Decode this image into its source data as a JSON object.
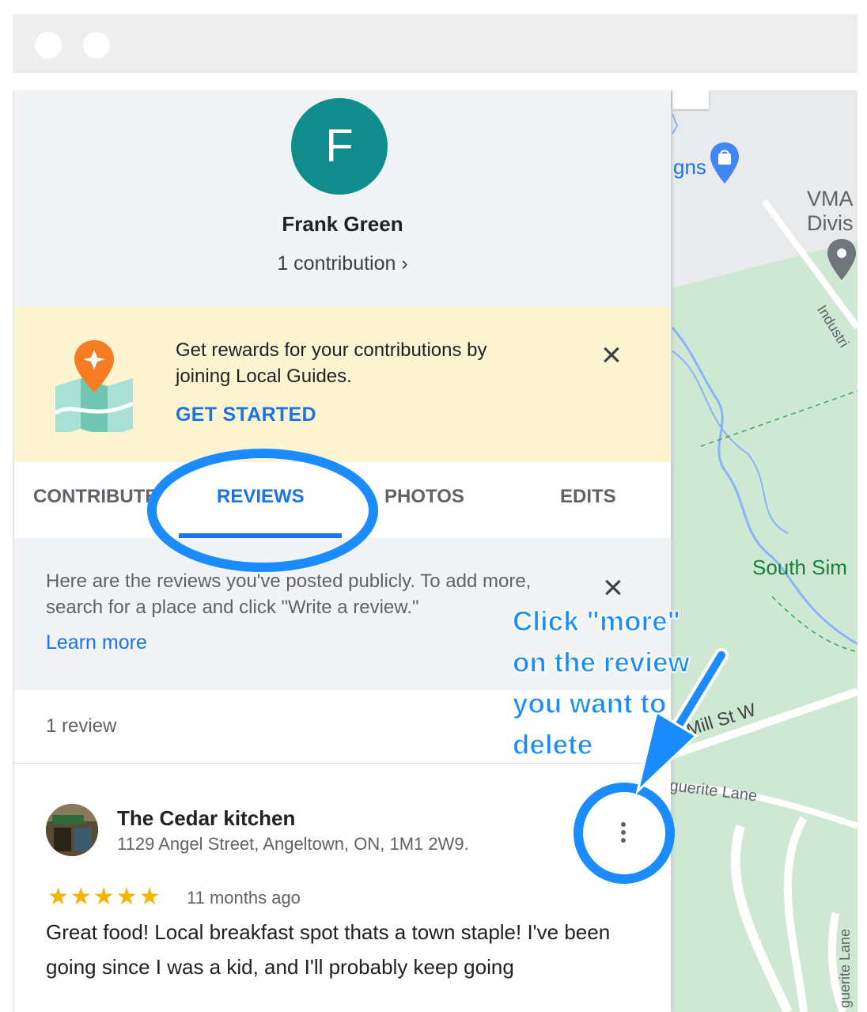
{
  "map": {
    "labels": {
      "signs": "gns",
      "vma": "VMA\nDivis",
      "south": "South Sim",
      "mill": "Mill St W",
      "marguerite": "guerite Lane",
      "industrial": "Industri",
      "lane": "guerite Lane"
    },
    "icons": [
      "shopping-bag-pin-icon",
      "location-pin-icon"
    ]
  },
  "profile": {
    "avatar_letter": "F",
    "avatar_color": "#108c8c",
    "name": "Frank Green",
    "contributions": "1 contribution ›"
  },
  "promo": {
    "text": "Get rewards for your contributions by joining Local Guides.",
    "cta": "GET STARTED",
    "background": "#fdf4d1"
  },
  "tabs": [
    {
      "label": "CONTRIBUTE",
      "active": false
    },
    {
      "label": "REVIEWS",
      "active": true
    },
    {
      "label": "PHOTOS",
      "active": false
    },
    {
      "label": "EDITS",
      "active": false
    }
  ],
  "info": {
    "text": "Here are the reviews you've posted publicly. To add more, search for a place and click \"Write a review.\"",
    "link": "Learn more"
  },
  "reviews": {
    "count_label": "1 review",
    "items": [
      {
        "place": "The Cedar kitchen",
        "address": "1129 Angel Street, Angeltown, ON, 1M1 2W9.",
        "stars": "★★★★★",
        "rating": 5,
        "time": "11 months ago",
        "text": "Great food! Local breakfast spot thats a town staple! I've been going since I was a kid, and I'll probably keep going"
      }
    ]
  },
  "annotation": {
    "callout_lines": [
      "Click \"more\"",
      "on the review",
      "you want to",
      "delete"
    ],
    "color": "#1a8cff"
  },
  "colors": {
    "accent": "#1a73e8",
    "star": "#f4b400"
  }
}
